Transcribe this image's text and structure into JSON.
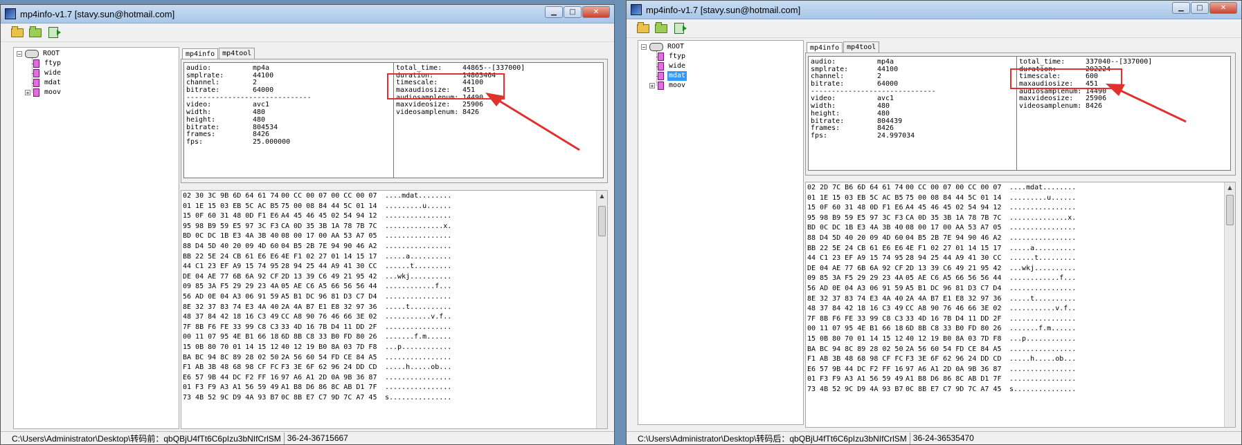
{
  "accent": {
    "annotation": "#e03030",
    "selection": "#3399ff"
  },
  "left": {
    "title": "mp4info-v1.7 [stavy.sun@hotmail.com]",
    "tabs": [
      "mp4info",
      "mp4tool"
    ],
    "tree": {
      "root": "ROOT",
      "children": [
        "ftyp",
        "wide",
        "mdat",
        "moov"
      ],
      "selected": "",
      "expanded": [
        "ROOT"
      ]
    },
    "audio_video_lines": [
      [
        "audio:",
        "mp4a"
      ],
      [
        "smplrate:",
        "44100"
      ],
      [
        "channel:",
        "2"
      ],
      [
        "bitrate:",
        "64000"
      ],
      [
        "------------------------------",
        ""
      ],
      [
        "video:",
        "avc1"
      ],
      [
        "width:",
        "480"
      ],
      [
        "height:",
        "480"
      ],
      [
        "bitrate:",
        "804534"
      ],
      [
        "frames:",
        "8426"
      ],
      [
        "fps:",
        "25.000000"
      ]
    ],
    "time_lines": [
      [
        "total_time:",
        "44865--[337000]"
      ],
      [
        "duration:",
        "14863464"
      ],
      [
        "timescale:",
        "44100"
      ],
      [
        "maxaudiosize:",
        "451"
      ],
      [
        "audiosamplenum:",
        "14490"
      ],
      [
        "maxvideosize:",
        "25906"
      ],
      [
        "videosamplenum:",
        "8426"
      ]
    ],
    "hex_rows": [
      [
        "02 30 3C 9B 6D 64 61 74",
        "00 CC 00 07 00 CC 00 07",
        "....mdat........"
      ],
      [
        "01 1E 15 03 EB 5C AC B5",
        "75 00 08 84 44 5C 01 14",
        ".........u......"
      ],
      [
        "15 0F 60 31 48 0D F1 E6",
        "A4 45 46 45 02 54 94 12",
        "................"
      ],
      [
        "95 98 B9 59 E5 97 3C F3",
        "CA 0D 35 3B 1A 78 7B 7C",
        "..............x."
      ],
      [
        "BD 0C DC 1B E3 4A 3B 40",
        "08 00 17 00 AA 53 A7 05",
        "................"
      ],
      [
        "88 D4 5D 40 20 09 4D 60",
        "04 B5 2B 7E 94 90 46 A2",
        "................"
      ],
      [
        "BB 22 5E 24 CB 61 E6 E6",
        "4E F1 02 27 01 14 15 17",
        ".....a.........."
      ],
      [
        "44 C1 23 EF A9 15 74 95",
        "28 94 25 44 A9 41 30 CC",
        "......t........."
      ],
      [
        "DE 04 AE 77 6B 6A 92 CF",
        "2D 13 39 C6 49 21 95 42",
        "...wkj.........."
      ],
      [
        "09 85 3A F5 29 29 23 4A",
        "05 AE C6 A5 66 56 56 44",
        "............f..."
      ],
      [
        "56 AD 0E 04 A3 06 91 59",
        "A5 B1 DC 96 81 D3 C7 D4",
        "................"
      ],
      [
        "8E 32 37 83 74 E3 4A 40",
        "2A 4A B7 E1 E8 32 97 36",
        ".....t.........."
      ],
      [
        "48 37 84 42 18 16 C3 49",
        "CC A8 90 76 46 66 3E 02",
        "...........v.f.."
      ],
      [
        "7F 8B F6 FE 33 99 C8 C3",
        "33 4D 16 7B D4 11 DD 2F",
        "................"
      ],
      [
        "00 11 07 95 4E B1 66 18",
        "6D 8B C8 33 B0 FD 80 26",
        ".......f.m......"
      ],
      [
        "15 0B 80 70 01 14 15 12",
        "40 12 19 B0 8A 03 7D F8",
        "...p............"
      ],
      [
        "BA BC 94 8C 89 28 02 50",
        "2A 56 60 54 FD CE 84 A5",
        "................"
      ],
      [
        "F1 AB 3B 48 68 98 CF FC",
        "F3 3E 6F 62 96 24 DD CD",
        ".....h.....ob..."
      ],
      [
        "E6 57 9B 44 DC F2 FF 16",
        "97 A6 A1 2D 0A 9B 36 87",
        "................"
      ],
      [
        "01 F3 F9 A3 A1 56 59 49",
        "A1 B8 D6 86 8C AB D1 7F",
        "................"
      ],
      [
        "73 4B 52 9C D9 4A 93 B7",
        "0C 8B E7 C7 9D 7C A7 45",
        "s..............."
      ]
    ],
    "status_path": "C:\\Users\\Administrator\\Desktop\\转码前：qbQBjU4fTt6C6pIzu3bNIfCrlSM",
    "status_info": "36-24-36715667"
  },
  "right": {
    "title": "mp4info-v1.7 [stavy.sun@hotmail.com]",
    "tabs": [
      "mp4info",
      "mp4tool"
    ],
    "tree": {
      "root": "ROOT",
      "children": [
        "ftyp",
        "wide",
        "mdat",
        "moov"
      ],
      "selected": "mdat",
      "expanded": [
        "ROOT"
      ]
    },
    "audio_video_lines": [
      [
        "audio:",
        "mp4a"
      ],
      [
        "smplrate:",
        "44100"
      ],
      [
        "channel:",
        "2"
      ],
      [
        "bitrate:",
        "64000"
      ],
      [
        "------------------------------",
        ""
      ],
      [
        "video:",
        "avc1"
      ],
      [
        "width:",
        "480"
      ],
      [
        "height:",
        "480"
      ],
      [
        "bitrate:",
        "804439"
      ],
      [
        "frames:",
        "8426"
      ],
      [
        "fps:",
        "24.997034"
      ]
    ],
    "time_lines": [
      [
        "total_time:",
        "337040--[337000]"
      ],
      [
        "duration:",
        "202224"
      ],
      [
        "timescale:",
        "600"
      ],
      [
        "maxaudiosize:",
        "451"
      ],
      [
        "audiosamplenum:",
        "14490"
      ],
      [
        "maxvideosize:",
        "25906"
      ],
      [
        "videosamplenum:",
        "8426"
      ]
    ],
    "hex_rows": [
      [
        "02 2D 7C B6 6D 64 61 74",
        "00 CC 00 07 00 CC 00 07",
        "....mdat........"
      ],
      [
        "01 1E 15 03 EB 5C AC B5",
        "75 00 08 84 44 5C 01 14",
        ".........u......"
      ],
      [
        "15 0F 60 31 48 0D F1 E6",
        "A4 45 46 45 02 54 94 12",
        "................"
      ],
      [
        "95 98 B9 59 E5 97 3C F3",
        "CA 0D 35 3B 1A 78 7B 7C",
        "..............x."
      ],
      [
        "BD 0C DC 1B E3 4A 3B 40",
        "08 00 17 00 AA 53 A7 05",
        "................"
      ],
      [
        "88 D4 5D 40 20 09 4D 60",
        "04 B5 2B 7E 94 90 46 A2",
        "................"
      ],
      [
        "BB 22 5E 24 CB 61 E6 E6",
        "4E F1 02 27 01 14 15 17",
        ".....a.........."
      ],
      [
        "44 C1 23 EF A9 15 74 95",
        "28 94 25 44 A9 41 30 CC",
        "......t........."
      ],
      [
        "DE 04 AE 77 6B 6A 92 CF",
        "2D 13 39 C6 49 21 95 42",
        "...wkj.........."
      ],
      [
        "09 85 3A F5 29 29 23 4A",
        "05 AE C6 A5 66 56 56 44",
        "............f..."
      ],
      [
        "56 AD 0E 04 A3 06 91 59",
        "A5 B1 DC 96 81 D3 C7 D4",
        "................"
      ],
      [
        "8E 32 37 83 74 E3 4A 40",
        "2A 4A B7 E1 E8 32 97 36",
        ".....t.........."
      ],
      [
        "48 37 84 42 18 16 C3 49",
        "CC A8 90 76 46 66 3E 02",
        "...........v.f.."
      ],
      [
        "7F 8B F6 FE 33 99 C8 C3",
        "33 4D 16 7B D4 11 DD 2F",
        "................"
      ],
      [
        "00 11 07 95 4E B1 66 18",
        "6D 8B C8 33 B0 FD 80 26",
        ".......f.m......"
      ],
      [
        "15 0B 80 70 01 14 15 12",
        "40 12 19 B0 8A 03 7D F8",
        "...p............"
      ],
      [
        "BA BC 94 8C 89 28 02 50",
        "2A 56 60 54 FD CE 84 A5",
        "................"
      ],
      [
        "F1 AB 3B 48 68 98 CF FC",
        "F3 3E 6F 62 96 24 DD CD",
        ".....h.....ob..."
      ],
      [
        "E6 57 9B 44 DC F2 FF 16",
        "97 A6 A1 2D 0A 9B 36 87",
        "................"
      ],
      [
        "01 F3 F9 A3 A1 56 59 49",
        "A1 B8 D6 86 8C AB D1 7F",
        "................"
      ],
      [
        "73 4B 52 9C D9 4A 93 B7",
        "0C 8B E7 C7 9D 7C A7 45",
        "s..............."
      ]
    ],
    "status_path": "C:\\Users\\Administrator\\Desktop\\转码后：qbQBjU4fTt6C6pIzu3bNIfCrlSM",
    "status_info": "36-24-36535470"
  }
}
